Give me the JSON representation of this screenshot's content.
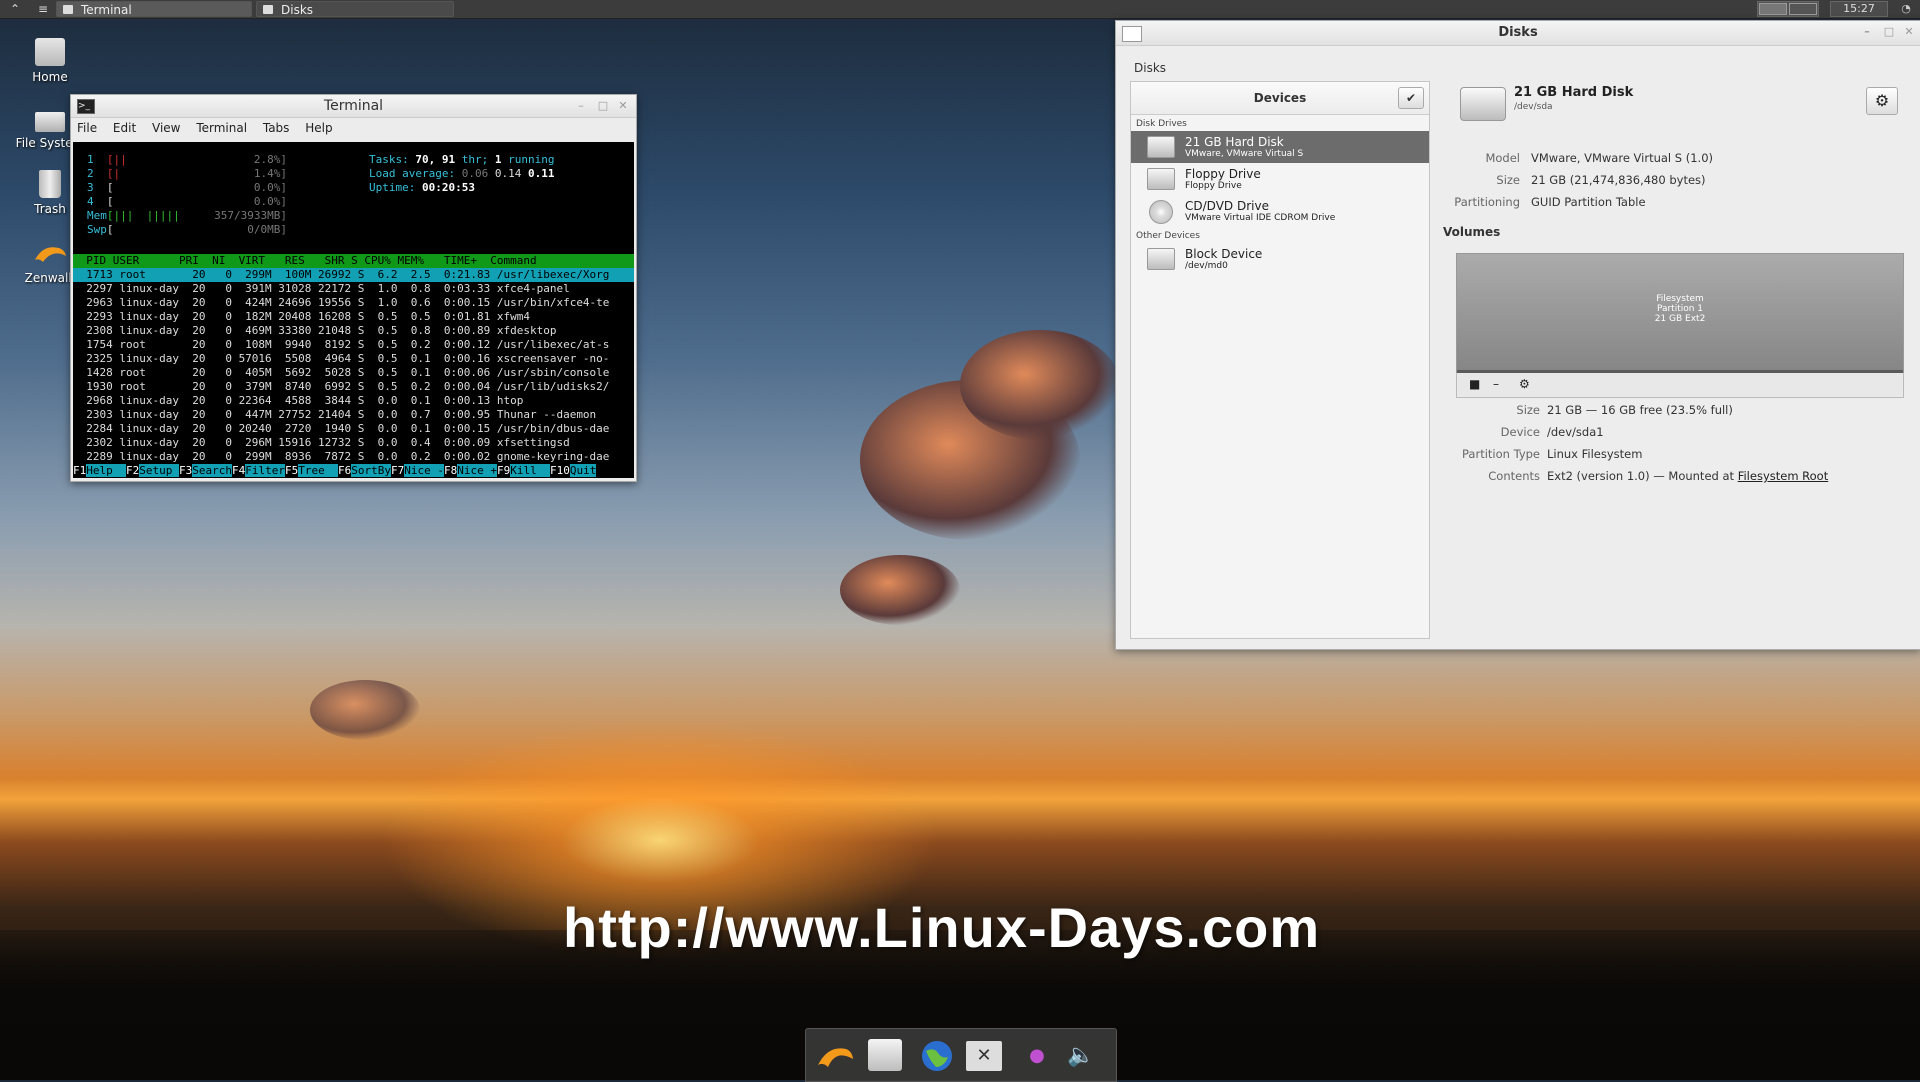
{
  "top_panel": {
    "tasks": [
      {
        "label": "Terminal"
      },
      {
        "label": "Disks"
      }
    ],
    "clock": "15:27"
  },
  "desktop_icons": [
    {
      "label": "Home"
    },
    {
      "label": "File System"
    },
    {
      "label": "Trash"
    },
    {
      "label": "Zenwalk"
    }
  ],
  "terminal": {
    "title": "Terminal",
    "menu": [
      "File",
      "Edit",
      "View",
      "Terminal",
      "Tabs",
      "Help"
    ],
    "cpu_rows": [
      {
        "num": "1",
        "bar": "[||",
        "pct": "2.8%]"
      },
      {
        "num": "2",
        "bar": "[|",
        "pct": "1.4%]"
      },
      {
        "num": "3",
        "bar": "[",
        "pct": "0.0%]"
      },
      {
        "num": "4",
        "bar": "[",
        "pct": "0.0%]"
      }
    ],
    "mem": {
      "label": "Mem",
      "bar": "[|||  |||||",
      "value": "357/3933MB]"
    },
    "swp": {
      "label": "Swp",
      "bar": "[",
      "value": "0/0MB]"
    },
    "tasks_line": {
      "label": "Tasks:",
      "tasks": "70,",
      "threads": "91",
      "thr_label": "thr;",
      "running": "1",
      "running_label": "running"
    },
    "load_line": {
      "label": "Load average:",
      "v1": "0.06",
      "v2": "0.14",
      "v3": "0.11"
    },
    "uptime_line": {
      "label": "Uptime:",
      "value": "00:20:53"
    },
    "header": "  PID USER      PRI  NI  VIRT   RES   SHR S CPU% MEM%   TIME+  Command",
    "processes": [
      "  1713 root       20   0  299M  100M 26992 S  6.2  2.5  0:21.83 /usr/libexec/Xorg",
      "  2297 linux-day  20   0  391M 31028 22172 S  1.0  0.8  0:03.33 xfce4-panel",
      "  2963 linux-day  20   0  424M 24696 19556 S  1.0  0.6  0:00.15 /usr/bin/xfce4-te",
      "  2293 linux-day  20   0  182M 20408 16208 S  0.5  0.5  0:01.81 xfwm4",
      "  2308 linux-day  20   0  469M 33380 21048 S  0.5  0.8  0:00.89 xfdesktop",
      "  1754 root       20   0  108M  9940  8192 S  0.5  0.2  0:00.12 /usr/libexec/at-s",
      "  2325 linux-day  20   0 57016  5508  4964 S  0.5  0.1  0:00.16 xscreensaver -no-",
      "  1428 root       20   0  405M  5692  5028 S  0.5  0.1  0:00.06 /usr/sbin/console",
      "  1930 root       20   0  379M  8740  6992 S  0.5  0.2  0:00.04 /usr/lib/udisks2/",
      "  2968 linux-day  20   0 22364  4588  3844 S  0.0  0.1  0:00.13 htop",
      "  2303 linux-day  20   0  447M 27752 21404 S  0.0  0.7  0:00.95 Thunar --daemon",
      "  2284 linux-day  20   0 20240  2720  1940 S  0.0  0.1  0:00.15 /usr/bin/dbus-dae",
      "  2302 linux-day  20   0  296M 15916 12732 S  0.0  0.4  0:00.09 xfsettingsd",
      "  2289 linux-day  20   0  299M  8936  7872 S  0.0  0.2  0:00.02 gnome-keyring-dae"
    ],
    "fkeys": [
      {
        "key": "F1",
        "label": "Help  "
      },
      {
        "key": "F2",
        "label": "Setup "
      },
      {
        "key": "F3",
        "label": "Search"
      },
      {
        "key": "F4",
        "label": "Filter"
      },
      {
        "key": "F5",
        "label": "Tree  "
      },
      {
        "key": "F6",
        "label": "SortBy"
      },
      {
        "key": "F7",
        "label": "Nice -"
      },
      {
        "key": "F8",
        "label": "Nice +"
      },
      {
        "key": "F9",
        "label": "Kill  "
      },
      {
        "key": "F10",
        "label": "Quit"
      }
    ]
  },
  "disks": {
    "title": "Disks",
    "app_label": "Disks",
    "devices_header": "Devices",
    "section_disk_drives": "Disk Drives",
    "section_other": "Other Devices",
    "devices": [
      {
        "name": "21 GB Hard Disk",
        "sub": "VMware, VMware Virtual S"
      },
      {
        "name": "Floppy Drive",
        "sub": "Floppy Drive"
      },
      {
        "name": "CD/DVD Drive",
        "sub": "VMware Virtual IDE CDROM Drive"
      }
    ],
    "other_devices": [
      {
        "name": "Block Device",
        "sub": "/dev/md0"
      }
    ],
    "selected": {
      "name": "21 GB Hard Disk",
      "device": "/dev/sda",
      "model_label": "Model",
      "model": "VMware, VMware Virtual S (1.0)",
      "size_label": "Size",
      "size": "21 GB (21,474,836,480 bytes)",
      "partitioning_label": "Partitioning",
      "partitioning": "GUID Partition Table"
    },
    "volumes_label": "Volumes",
    "volume_box": {
      "line1": "Filesystem",
      "line2": "Partition 1",
      "line3": "21 GB Ext2"
    },
    "volume": {
      "size_label": "Size",
      "size": "21 GB — 16 GB free (23.5% full)",
      "device_label": "Device",
      "device": "/dev/sda1",
      "ptype_label": "Partition Type",
      "ptype": "Linux Filesystem",
      "contents_label": "Contents",
      "contents_pre": "Ext2 (version 1.0) — Mounted at",
      "contents_link": "Filesystem Root"
    }
  },
  "watermark": "http://www.Linux-Days.com"
}
